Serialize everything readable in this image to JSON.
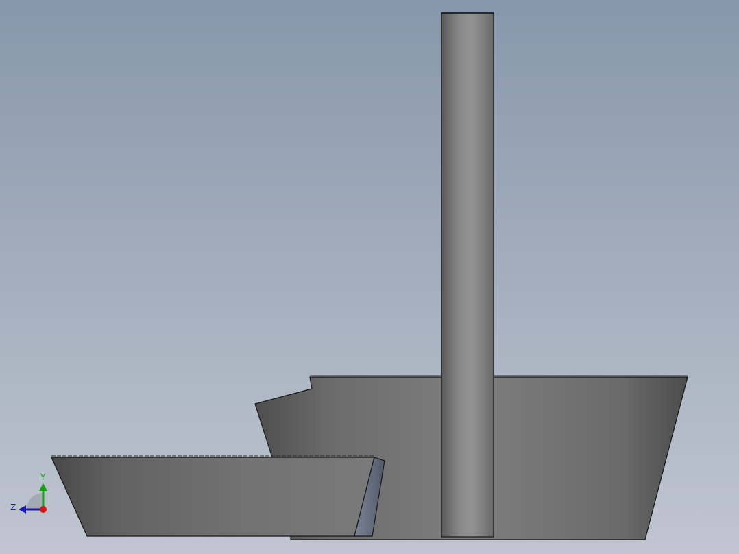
{
  "colors": {
    "background_top": "#8797ab",
    "background_bottom": "#c0c6d0",
    "part_light": "#8f8f8f",
    "part_dark": "#4c4c4c",
    "edge": "#151515",
    "axis_x": "#d01818",
    "axis_y": "#13a313",
    "axis_z": "#1a1ab8"
  },
  "triad": {
    "y_label": "Y",
    "z_label": "Z"
  }
}
